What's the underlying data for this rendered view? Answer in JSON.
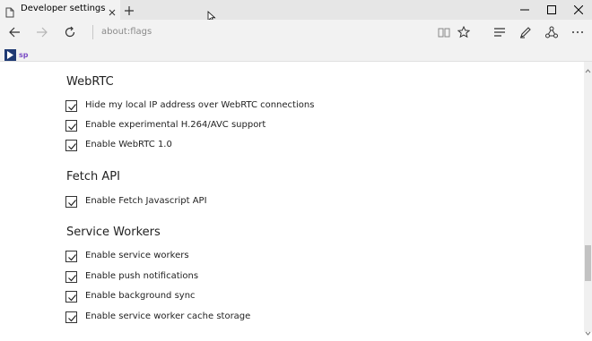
{
  "colors": {
    "tab_bar": "#e6e6e6",
    "active_tab": "#f2f2f2",
    "accent": "#1a73c9"
  },
  "tab": {
    "title": "Developer settings",
    "icon": "page-icon"
  },
  "address_bar": {
    "url": "about:flags"
  },
  "toolbar": {
    "icons": [
      "back-icon",
      "forward-icon",
      "refresh-icon",
      "reading-view-icon",
      "favorite-star-icon",
      "hub-icon",
      "web-note-icon",
      "share-icon",
      "more-icon"
    ]
  },
  "window_controls": [
    "minimize-icon",
    "maximize-icon",
    "close-icon"
  ],
  "favorites": [
    {
      "icon": "bookmark-icon-1"
    },
    {
      "icon": "sp-icon",
      "text": "sp"
    }
  ],
  "sections": [
    {
      "title": "WebRTC",
      "flags": [
        {
          "label": "Hide my local IP address over WebRTC connections",
          "checked": true
        },
        {
          "label": "Enable experimental H.264/AVC support",
          "checked": true
        },
        {
          "label": "Enable WebRTC 1.0",
          "checked": true
        }
      ]
    },
    {
      "title": "Fetch API",
      "flags": [
        {
          "label": "Enable Fetch Javascript API",
          "checked": true
        }
      ]
    },
    {
      "title": "Service Workers",
      "flags": [
        {
          "label": "Enable service workers",
          "checked": true
        },
        {
          "label": "Enable push notifications",
          "checked": true
        },
        {
          "label": "Enable background sync",
          "checked": true
        },
        {
          "label": "Enable service worker cache storage",
          "checked": true
        }
      ]
    }
  ]
}
